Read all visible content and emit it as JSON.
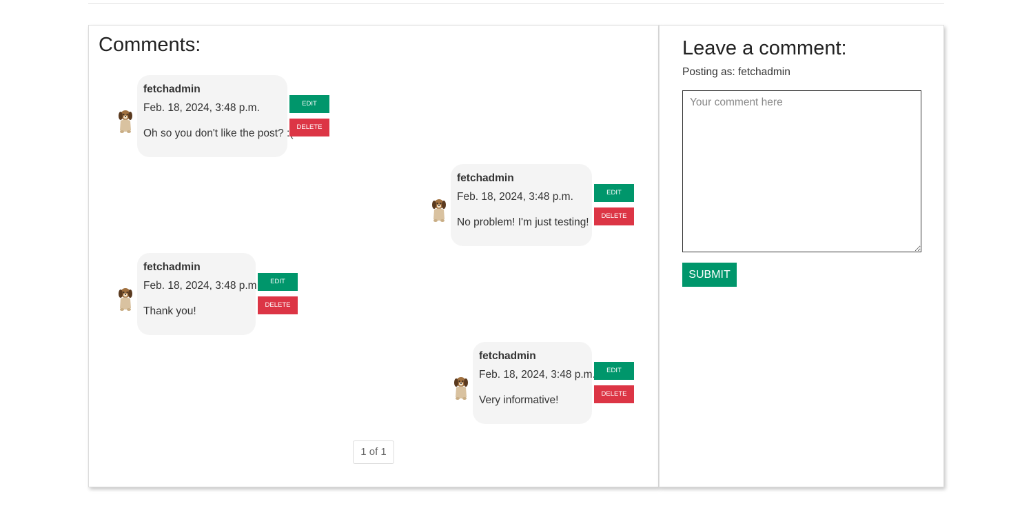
{
  "comments_section": {
    "title": "Comments:",
    "comments": [
      {
        "author": "fetchadmin",
        "date": "Feb. 18, 2024, 3:48 p.m.",
        "text": "Oh so you don't like the post? :(",
        "edit_label": "EDIT",
        "delete_label": "DELETE"
      },
      {
        "author": "fetchadmin",
        "date": "Feb. 18, 2024, 3:48 p.m.",
        "text": "No problem! I'm just testing!",
        "edit_label": "EDIT",
        "delete_label": "DELETE"
      },
      {
        "author": "fetchadmin",
        "date": "Feb. 18, 2024, 3:48 p.m.",
        "text": "Thank you!",
        "edit_label": "EDIT",
        "delete_label": "DELETE"
      },
      {
        "author": "fetchadmin",
        "date": "Feb. 18, 2024, 3:48 p.m.",
        "text": "Very informative!",
        "edit_label": "EDIT",
        "delete_label": "DELETE"
      }
    ],
    "pagination": "1 of 1"
  },
  "comment_form": {
    "title": "Leave a comment:",
    "posting_as": "Posting as: fetchadmin",
    "placeholder": "Your comment here",
    "submit_label": "SUBMIT"
  },
  "colors": {
    "edit_button": "#00966b",
    "delete_button": "#dc3545",
    "submit_button": "#00966b",
    "bubble_background": "#f4f4f4"
  },
  "icons": {
    "avatar": "puppy-avatar-icon"
  }
}
